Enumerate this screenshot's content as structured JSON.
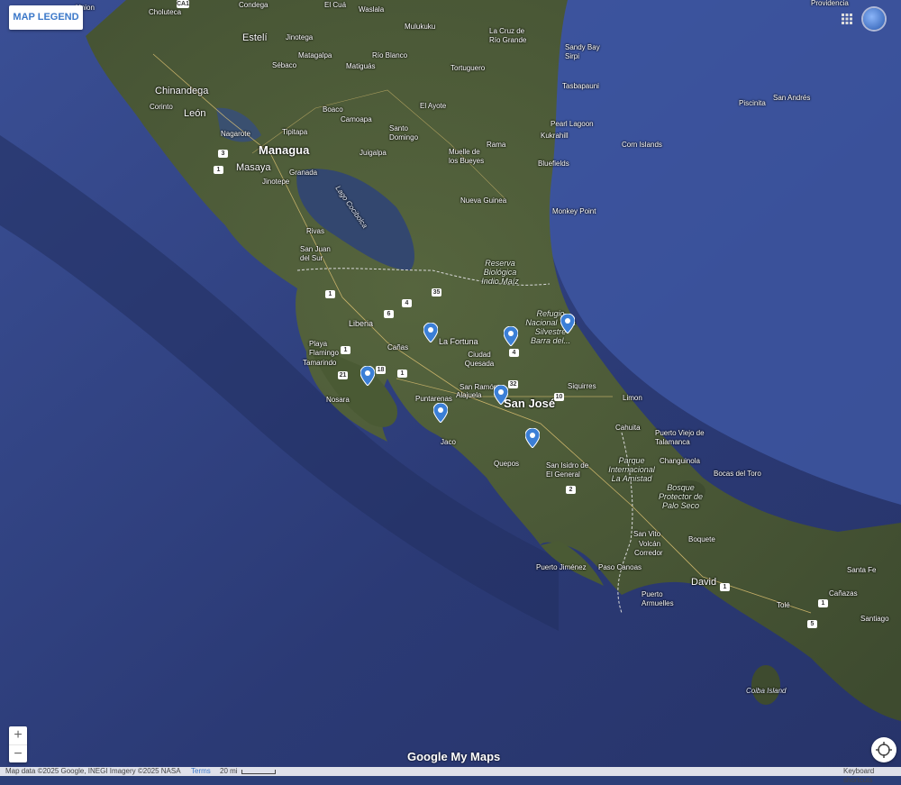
{
  "legend_button": "MAP LEGEND",
  "zoom": {
    "in": "+",
    "out": "−"
  },
  "footer": {
    "attribution": "Map data ©2025 Google, INEGI Imagery ©2025 NASA",
    "terms": "Terms",
    "scale": "20 mi",
    "shortcuts": "Keyboard shortcuts"
  },
  "brand": "Google My Maps",
  "places": {
    "choluteca": "Choluteca",
    "condega": "Condega",
    "el_cua": "El Cuá",
    "waslala": "Waslala",
    "estel": "Estelí",
    "jinotega": "Jinotega",
    "mulukuku": "Mulukuku",
    "la_cruz": "La Cruz de Río Grande",
    "sandy_bay": "Sandy Bay Sirpi",
    "matagalpa": "Matagalpa",
    "sebaco": "Sébaco",
    "rio_blanco": "Río Blanco",
    "matiguas": "Matiguás",
    "tortuguero": "Tortuguero",
    "chinandega": "Chinandega",
    "tasbapauni": "Tasbapauni",
    "corinto": "Corinto",
    "leon": "León",
    "el_ayote": "El Ayote",
    "boaco": "Boaco",
    "camoapa": "Camoapa",
    "pearl_lagoon": "Pearl Lagoon",
    "kukrahill": "Kukrahill",
    "nagarote": "Nagarote",
    "tipitapa": "Tipitapa",
    "santo_domingo": "Santo Domingo",
    "managua": "Managua",
    "rama": "Rama",
    "corn_islands": "Corn Islands",
    "masaya": "Masaya",
    "granada": "Granada",
    "juigalpa": "Juigalpa",
    "muelle": "Muelle de los Bueyes",
    "bluefields": "Bluefields",
    "jinotepe": "Jinotepe",
    "nueva_guinea": "Nueva Guinea",
    "monkey_point": "Monkey Point",
    "rivas": "Rivas",
    "san_juan": "San Juan del Sur",
    "lago": "Lago Cocibolca",
    "reserva": "Reserva Biológica Indio Maíz",
    "refugio": "Refugio Nacional Vida Silvestre Barra del...",
    "liberia": "Liberia",
    "la_fortuna": "La Fortuna",
    "playa_flamingo": "Playa Flamingo",
    "canas": "Cañas",
    "tamarindo": "Tamarindo",
    "ciudad_quesada": "Ciudad Quesada",
    "siquirres": "Siquirres",
    "nosara": "Nosara",
    "puntarenas": "Puntarenas",
    "san_ramon": "San Ramón",
    "alajuela": "Alajuela",
    "san_jose": "San José",
    "limon": "Limon",
    "jaco": "Jaco",
    "cahuita": "Cahuita",
    "puerto_viejo": "Puerto Viejo de Talamanca",
    "quepos": "Quepos",
    "san_isidro": "San Isidro de El General",
    "parque": "Parque Internacional La Amistad",
    "changuinola": "Changuinola",
    "bocas": "Bocas del Toro",
    "bosque": "Bosque Protector de Palo Seco",
    "san_vito": "San Vito",
    "volcan": "Volcán",
    "boquete": "Boquete",
    "corredor": "Corredor",
    "puerto_jimenez": "Puerto Jiménez",
    "paso_canoas": "Paso Canoas",
    "david": "David",
    "santa_fe": "Santa Fe",
    "puerto_armuelles": "Puerto Armuelles",
    "canazas": "Cañazas",
    "tole": "Tolé",
    "santiago": "Santiago",
    "coiba": "Coiba Island",
    "providencia": "Providencia",
    "san_andres": "San Andrés",
    "piscinita": "Piscinita",
    "union": "Union"
  },
  "shields": [
    "CA1",
    "3",
    "1",
    "35",
    "4",
    "6",
    "1",
    "4",
    "18",
    "21",
    "1",
    "32",
    "10",
    "2",
    "1",
    "1",
    "5",
    "1"
  ],
  "markers": [
    {
      "name": "la-fortuna-marker"
    },
    {
      "name": "ciudad-quesada-area-marker"
    },
    {
      "name": "tortuguero-refuge-marker"
    },
    {
      "name": "nicoya-marker"
    },
    {
      "name": "san-jose-marker"
    },
    {
      "name": "jaco-marker"
    },
    {
      "name": "san-isidro-marker"
    }
  ],
  "colors": {
    "ocean": "#2c3f78",
    "land": "#4b5a37",
    "marker": "#3b7fd6",
    "accent": "#3b78c9"
  }
}
